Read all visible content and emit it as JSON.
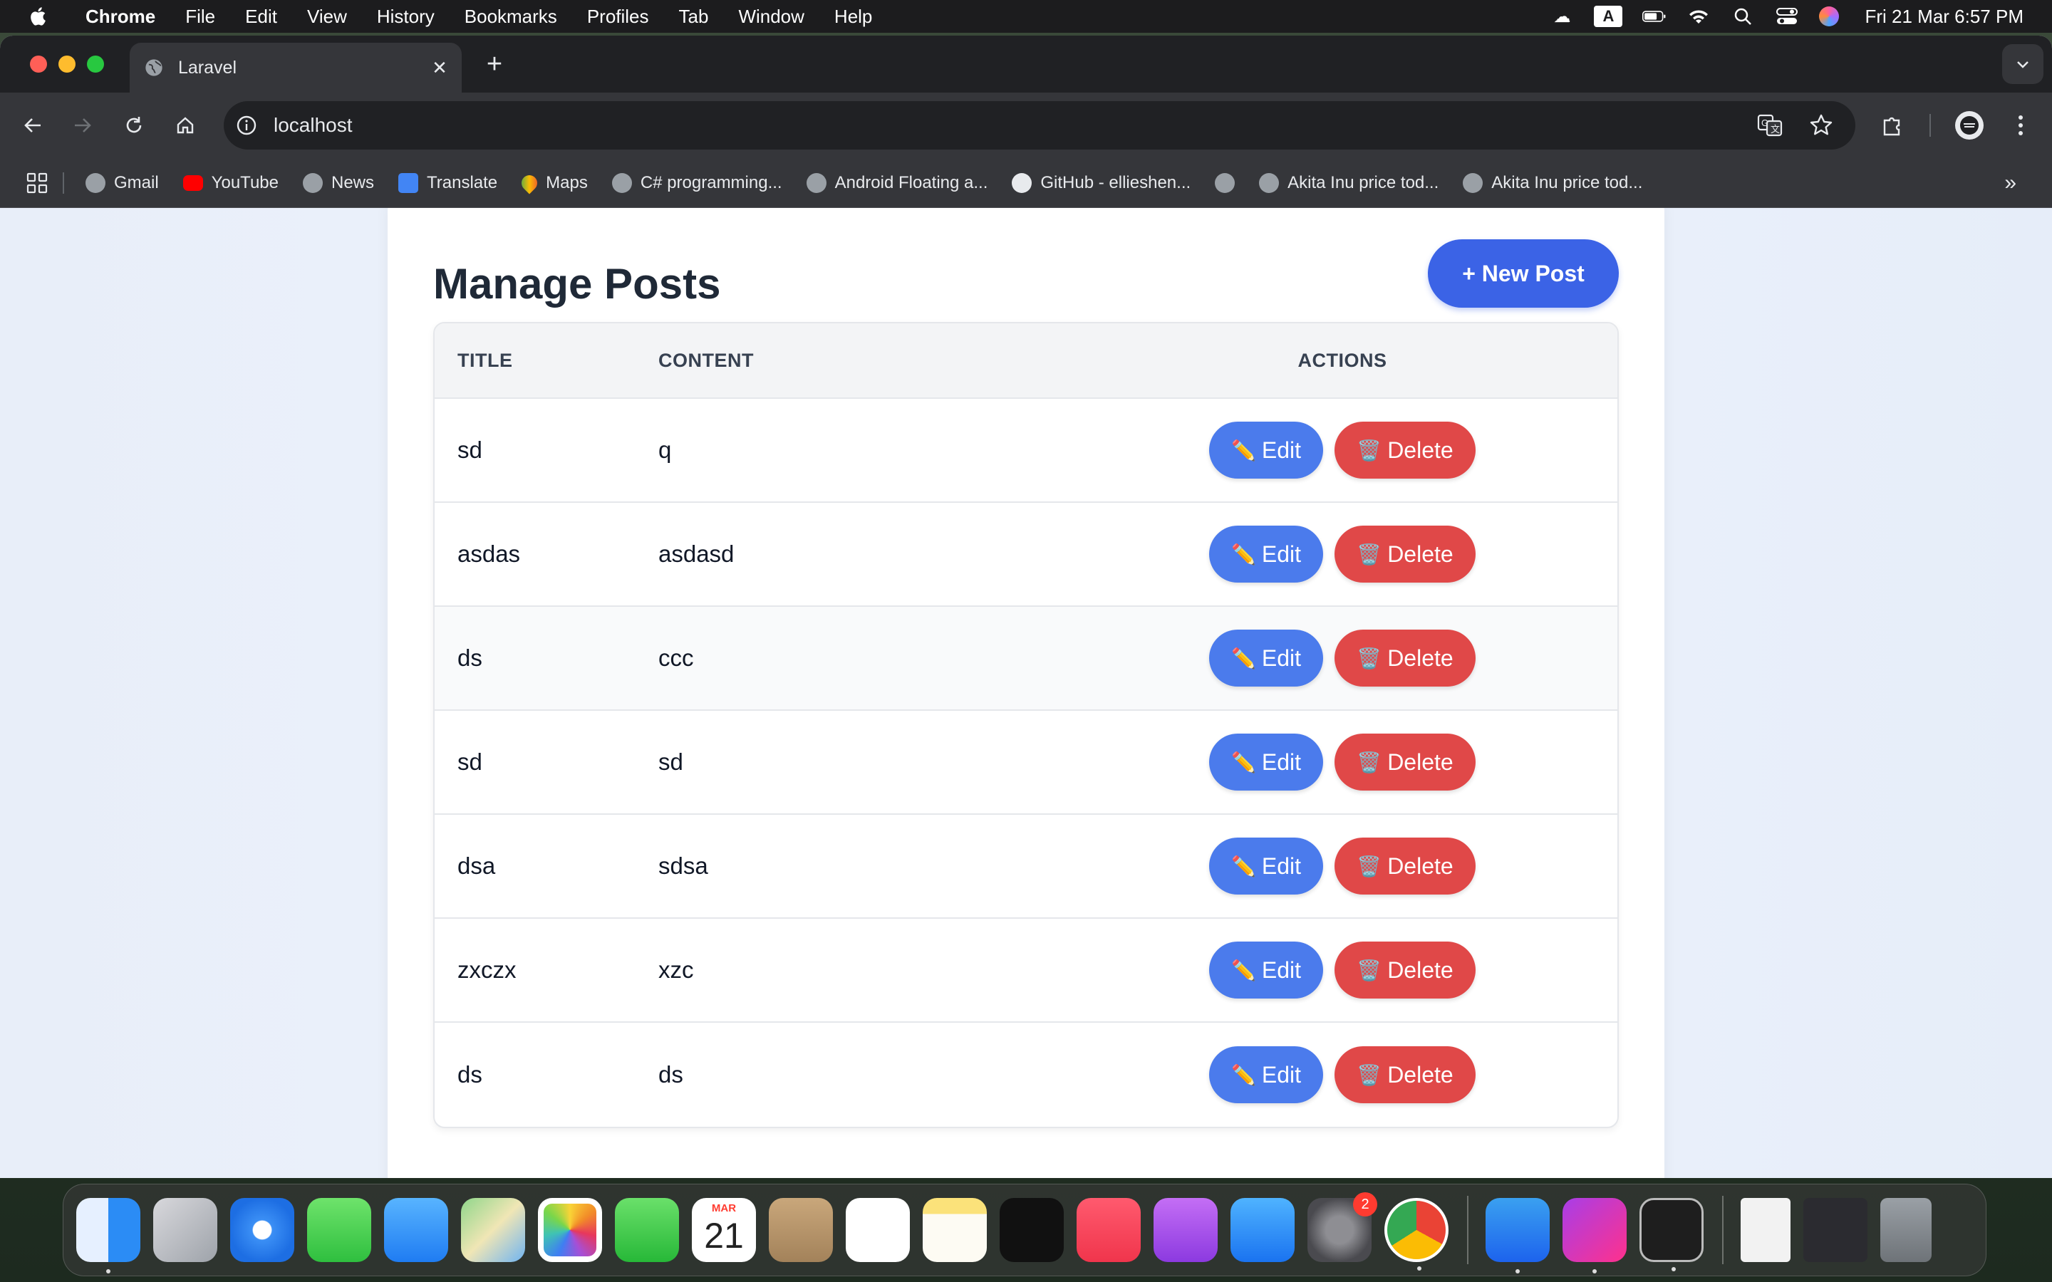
{
  "menubar": {
    "app_name": "Chrome",
    "items": [
      "File",
      "Edit",
      "View",
      "History",
      "Bookmarks",
      "Profiles",
      "Tab",
      "Window",
      "Help"
    ],
    "input_indicator": "A",
    "clock": "Fri 21 Mar  6:57 PM"
  },
  "browser": {
    "tab_title": "Laravel",
    "url": "localhost",
    "bookmarks": [
      "Gmail",
      "YouTube",
      "News",
      "Translate",
      "Maps",
      "C# programming...",
      "Android Floating a...",
      "GitHub - ellieshen...",
      "",
      "Akita Inu price tod...",
      "Akita Inu price tod..."
    ]
  },
  "page": {
    "title": "Manage Posts",
    "new_post_label": "+ New Post",
    "columns": {
      "title": "TITLE",
      "content": "CONTENT",
      "actions": "ACTIONS"
    },
    "edit_label": "Edit",
    "delete_label": "Delete",
    "edit_icon": "✏️",
    "delete_icon": "🗑️",
    "posts": [
      {
        "title": "sd",
        "content": "q"
      },
      {
        "title": "asdas",
        "content": "asdasd"
      },
      {
        "title": "ds",
        "content": "ccc"
      },
      {
        "title": "sd",
        "content": "sd"
      },
      {
        "title": "dsa",
        "content": "sdsa"
      },
      {
        "title": "zxczx",
        "content": "xzc"
      },
      {
        "title": "ds",
        "content": "ds"
      }
    ]
  },
  "dock": {
    "calendar_month": "MAR",
    "calendar_day": "21",
    "settings_badge": "2"
  },
  "colors": {
    "primary": "#3b63e6",
    "edit": "#4b7bec",
    "delete": "#e04848"
  }
}
